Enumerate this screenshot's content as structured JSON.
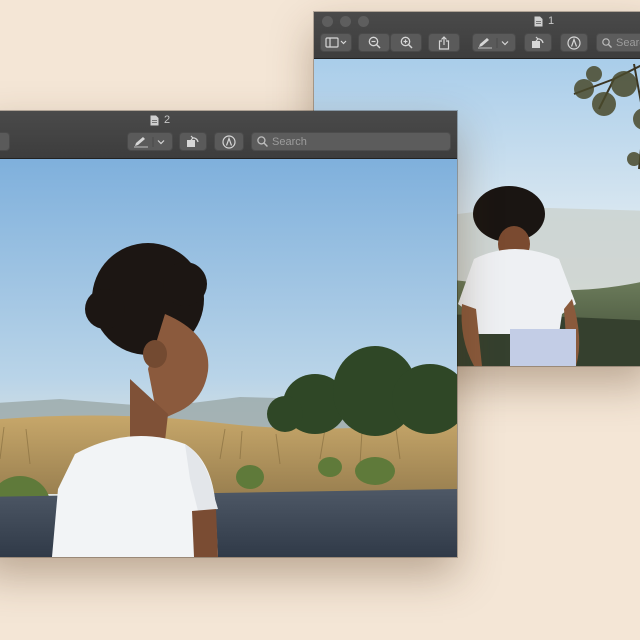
{
  "windows": {
    "back": {
      "title": "1",
      "search_placeholder": "Search"
    },
    "front": {
      "title": "2",
      "search_placeholder": "Search"
    }
  },
  "icons": {
    "document": "document-icon",
    "sidebar": "sidebar-toggle-icon",
    "zoom_out": "zoom-out-icon",
    "zoom_in": "zoom-in-icon",
    "share": "share-icon",
    "markup_pen": "pen-icon",
    "rotate": "rotate-icon",
    "annotate": "markup-icon",
    "search": "search-icon"
  }
}
